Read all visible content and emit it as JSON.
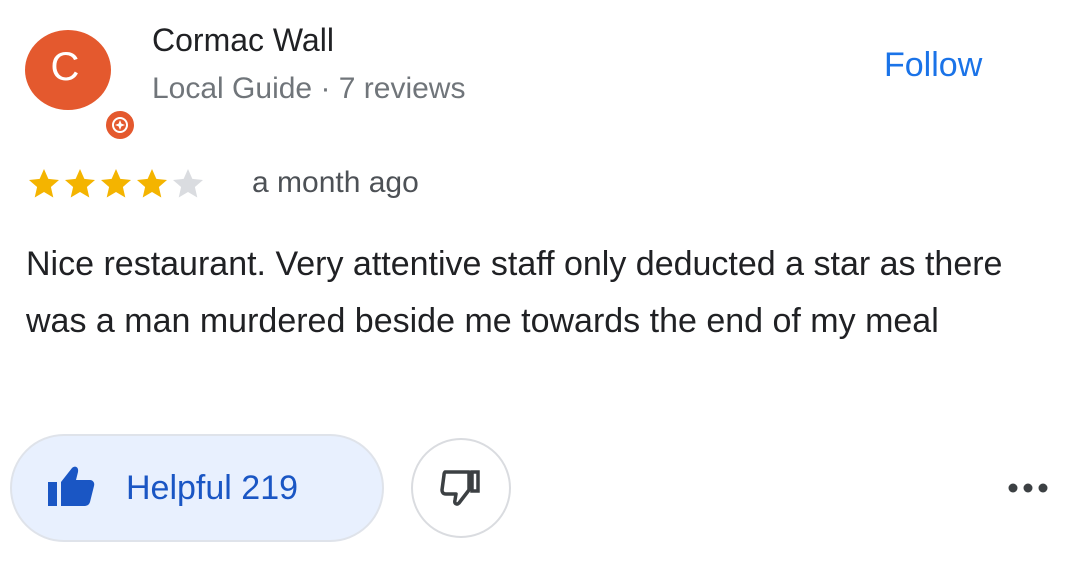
{
  "reviewer": {
    "avatar_letter": "C",
    "avatar_color": "#e4592e",
    "name": "Cormac Wall",
    "meta": "Local Guide · 7 reviews"
  },
  "follow_label": "Follow",
  "review": {
    "rating": 4,
    "max_rating": 5,
    "date": "a month ago",
    "text": "Nice restaurant. Very attentive staff only deducted a star as there was a man murdered beside me towards the end of my meal"
  },
  "actions": {
    "helpful_label": "Helpful 219",
    "helpful_icon": "thumbs-up-icon",
    "not_helpful_icon": "thumbs-down-icon",
    "more_icon": "more-options-icon"
  },
  "colors": {
    "accent": "#1a73e8",
    "star_filled": "#f4b400",
    "star_empty": "#dadce0",
    "helpful_bg": "#e8f0fe"
  }
}
